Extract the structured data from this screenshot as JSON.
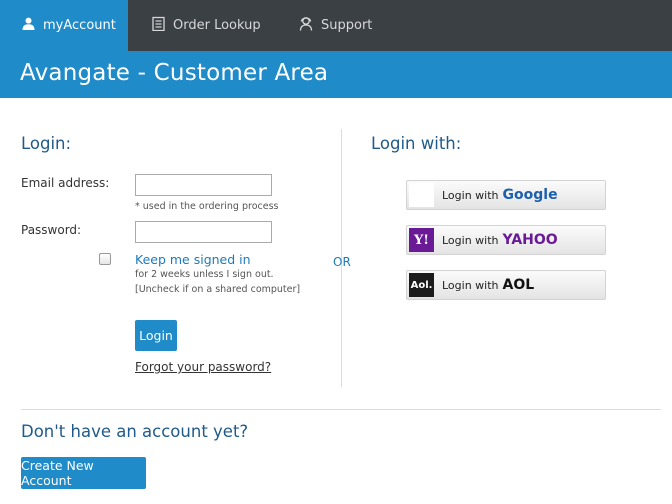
{
  "nav": {
    "tabs": [
      {
        "label": "myAccount",
        "icon": "user-icon",
        "active": true
      },
      {
        "label": "Order Lookup",
        "icon": "clipboard-icon",
        "active": false
      },
      {
        "label": "Support",
        "icon": "support-agent-icon",
        "active": false
      }
    ]
  },
  "banner": {
    "title": "Avangate - Customer Area"
  },
  "login": {
    "title": "Login:",
    "email_label": "Email address:",
    "email_value": "",
    "email_hint": "* used in the ordering process",
    "password_label": "Password:",
    "password_value": "",
    "keep_signed_in": {
      "label": "Keep me signed in",
      "checked": false,
      "note_1": "for 2 weeks unless I sign out.",
      "note_2": "[Uncheck if on a shared computer]"
    },
    "login_button": "Login",
    "forgot_link": "Forgot your password?"
  },
  "divider_or": "OR",
  "login_with": {
    "title": "Login with:",
    "providers": [
      {
        "prefix": "Login with",
        "brand": "Google",
        "icon": "google-logo-icon"
      },
      {
        "prefix": "Login with",
        "brand": "YAHOO",
        "icon": "yahoo-logo-icon"
      },
      {
        "prefix": "Login with",
        "brand": "AOL",
        "icon": "aol-logo-icon"
      }
    ]
  },
  "signup": {
    "title": "Don't have an account yet?",
    "create_button": "Create New Account"
  },
  "colors": {
    "accent": "#1f8bc9",
    "nav_bg": "#3b4045",
    "heading": "#1f5a8a"
  }
}
